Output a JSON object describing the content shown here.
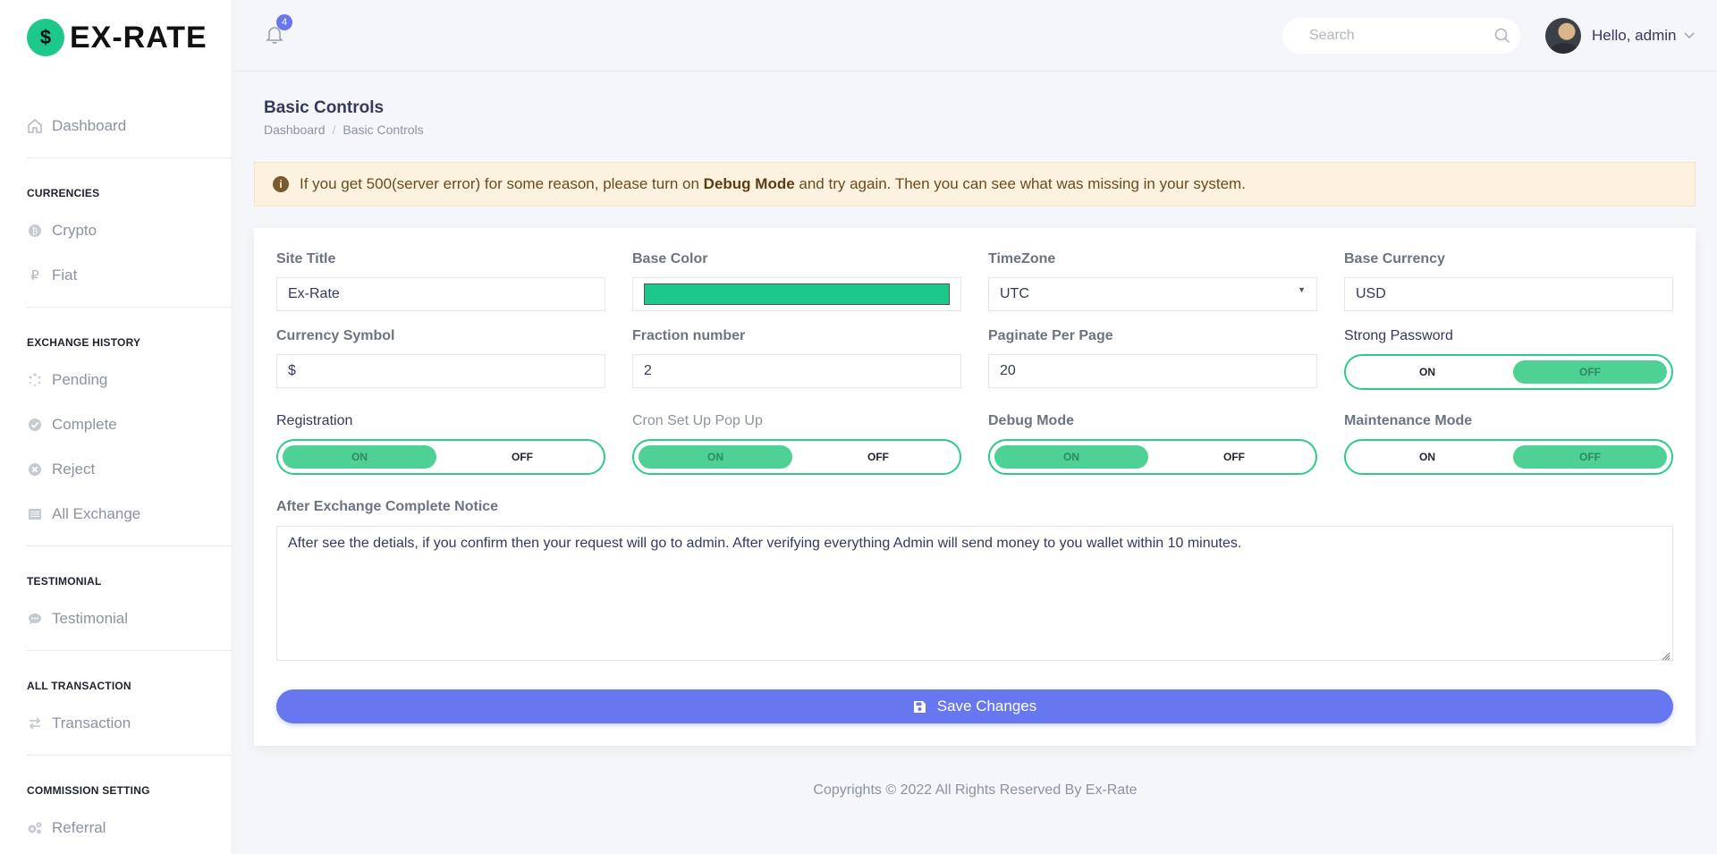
{
  "brand": {
    "logo_glyph": "$",
    "name": "EX-RATE",
    "accent": "#1cc88a"
  },
  "sidebar": {
    "dashboard": "Dashboard",
    "sections": [
      {
        "header": "CURRENCIES",
        "items": [
          {
            "label": "Crypto",
            "icon": "coin-icon"
          },
          {
            "label": "Fiat",
            "icon": "ruble-icon"
          }
        ]
      },
      {
        "header": "EXCHANGE HISTORY",
        "items": [
          {
            "label": "Pending",
            "icon": "spinner-icon"
          },
          {
            "label": "Complete",
            "icon": "check-circle-icon"
          },
          {
            "label": "Reject",
            "icon": "x-circle-icon"
          },
          {
            "label": "All Exchange",
            "icon": "list-icon"
          }
        ]
      },
      {
        "header": "TESTIMONIAL",
        "items": [
          {
            "label": "Testimonial",
            "icon": "comment-icon"
          }
        ]
      },
      {
        "header": "ALL TRANSACTION",
        "items": [
          {
            "label": "Transaction",
            "icon": "exchange-arrows-icon"
          }
        ]
      },
      {
        "header": "COMMISSION SETTING",
        "items": [
          {
            "label": "Referral",
            "icon": "cogs-icon"
          }
        ]
      }
    ]
  },
  "topbar": {
    "notification_count": "4",
    "search_placeholder": "Search",
    "greeting": "Hello, admin"
  },
  "page": {
    "title": "Basic Controls",
    "breadcrumb": [
      "Dashboard",
      "Basic Controls"
    ]
  },
  "alert": {
    "before": "If you get 500(server error) for some reason, please turn on ",
    "bold": "Debug Mode",
    "after": " and try again. Then you can see what was missing in your system."
  },
  "form": {
    "site_title": {
      "label": "Site Title",
      "value": "Ex-Rate"
    },
    "base_color": {
      "label": "Base Color",
      "value": "#1cc88a"
    },
    "timezone": {
      "label": "TimeZone",
      "value": "UTC"
    },
    "base_currency": {
      "label": "Base Currency",
      "value": "USD"
    },
    "currency_symbol": {
      "label": "Currency Symbol",
      "value": "$"
    },
    "fraction_number": {
      "label": "Fraction number",
      "value": "2"
    },
    "paginate_per_page": {
      "label": "Paginate Per Page",
      "value": "20"
    },
    "strong_password": {
      "label": "Strong Password",
      "on": "ON",
      "off": "OFF",
      "state": "off"
    },
    "registration": {
      "label": "Registration",
      "on": "ON",
      "off": "OFF",
      "state": "on"
    },
    "cron_popup": {
      "label": "Cron Set Up Pop Up",
      "on": "ON",
      "off": "OFF",
      "state": "on"
    },
    "debug_mode": {
      "label": "Debug Mode",
      "on": "ON",
      "off": "OFF",
      "state": "on"
    },
    "maintenance_mode": {
      "label": "Maintenance Mode",
      "on": "ON",
      "off": "OFF",
      "state": "off"
    },
    "notice": {
      "label": "After Exchange Complete Notice",
      "value": "After see the detials, if you confirm then your request will go to admin. After verifying everything Admin will send money to you wallet within 10 minutes."
    },
    "save_label": "Save Changes"
  },
  "footer": "Copyrights © 2022 All Rights Reserved By Ex-Rate"
}
